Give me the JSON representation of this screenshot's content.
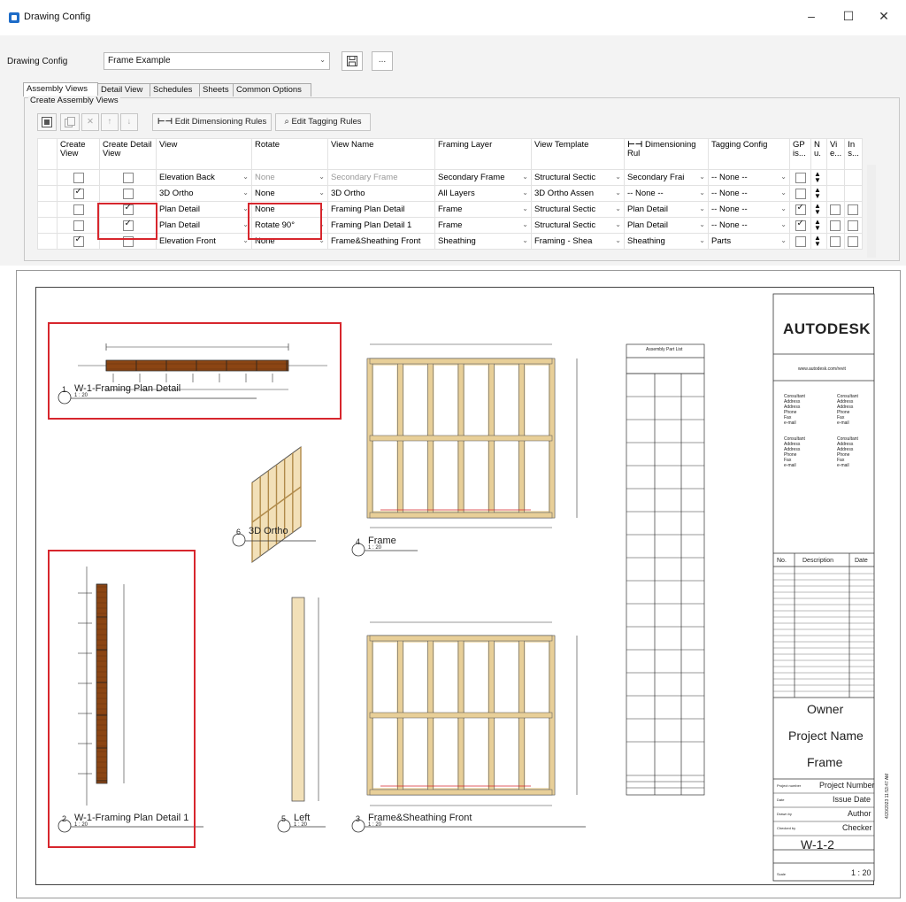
{
  "window": {
    "title": "Drawing Config",
    "controls": [
      "–",
      "☐",
      "✕"
    ]
  },
  "config": {
    "label": "Drawing Config",
    "value": "Frame Example",
    "save_icon": "save-icon",
    "more_label": "..."
  },
  "tabs": [
    "Assembly Views",
    "Detail View",
    "Schedules",
    "Sheets",
    "Common Options"
  ],
  "group_label": "Create Assembly Views",
  "toolbar": {
    "edit_dimensioning": "Edit Dimensioning Rules",
    "edit_tagging": "Edit Tagging Rules"
  },
  "columns": [
    "Create View",
    "Create Detail View",
    "View",
    "Rotate",
    "View Name",
    "Framing Layer",
    "View Template",
    "Dimensioning Rul",
    "Tagging Config",
    "GP is...",
    "N u.",
    "Vi e...",
    "In s..."
  ],
  "rows": [
    {
      "create": false,
      "detail": false,
      "view": "Elevation Back",
      "rotate": "None",
      "name": "Secondary Frame",
      "layer": "Secondary Frame",
      "template": "Structural Sectic",
      "dim": "Secondary Frai",
      "tag": "-- None --",
      "gp": false
    },
    {
      "create": true,
      "detail": false,
      "view": "3D Ortho",
      "rotate": "None",
      "name": "3D Ortho",
      "layer": "All Layers",
      "template": "3D Ortho Assen",
      "dim": "-- None --",
      "tag": "-- None --",
      "gp": false
    },
    {
      "create": false,
      "detail": true,
      "view": "Plan Detail",
      "rotate": "None",
      "name": "Framing Plan Detail",
      "layer": "Frame",
      "template": "Structural Sectic",
      "dim": "Plan Detail",
      "tag": "-- None --",
      "gp": true
    },
    {
      "create": false,
      "detail": true,
      "view": "Plan Detail",
      "rotate": "Rotate 90°",
      "name": "Framing Plan Detail 1",
      "layer": "Frame",
      "template": "Structural Sectic",
      "dim": "Plan Detail",
      "tag": "-- None --",
      "gp": true
    },
    {
      "create": true,
      "detail": false,
      "view": "Elevation Front",
      "rotate": "None",
      "name": "Frame&Sheathing Front",
      "layer": "Sheathing",
      "template": "Framing - Shea",
      "dim": "Sheathing",
      "tag": "Parts",
      "gp": false
    }
  ],
  "sheet": {
    "views": [
      {
        "num": "1",
        "title": "W-1-Framing Plan Detail",
        "scale": "1 : 20"
      },
      {
        "num": "2",
        "title": "W-1-Framing Plan Detail 1",
        "scale": "1 : 20"
      },
      {
        "num": "3",
        "title": "Frame&Sheathing Front",
        "scale": "1 : 20"
      },
      {
        "num": "4",
        "title": "Frame",
        "scale": "1 : 20"
      },
      {
        "num": "5",
        "title": "Left",
        "scale": "1 : 20"
      },
      {
        "num": "6",
        "title": "3D Ortho",
        "scale": ""
      }
    ],
    "schedule_title": "Assembly Part List",
    "titleblock": {
      "logo": "AUTODESK",
      "website": "www.autodesk.com/revit",
      "consultant_lines": [
        "Consultant",
        "Address",
        "Address",
        "Phone",
        "Fax",
        "e-mail"
      ],
      "rev_headers": [
        "No.",
        "Description",
        "Date"
      ],
      "owner": "Owner",
      "project_name": "Project Name",
      "sheet_name": "Frame",
      "project_number_label": "Project number",
      "project_number": "Project Number",
      "date_label": "Date",
      "date": "Issue Date",
      "drawn_label": "Drawn by",
      "drawn": "Author",
      "checked_label": "Checked by",
      "checked": "Checker",
      "sheet_number": "W-1-2",
      "scale_label": "Scale",
      "scale": "1 : 20",
      "side_text": "4/20/2023 11:53:47 AM"
    }
  }
}
